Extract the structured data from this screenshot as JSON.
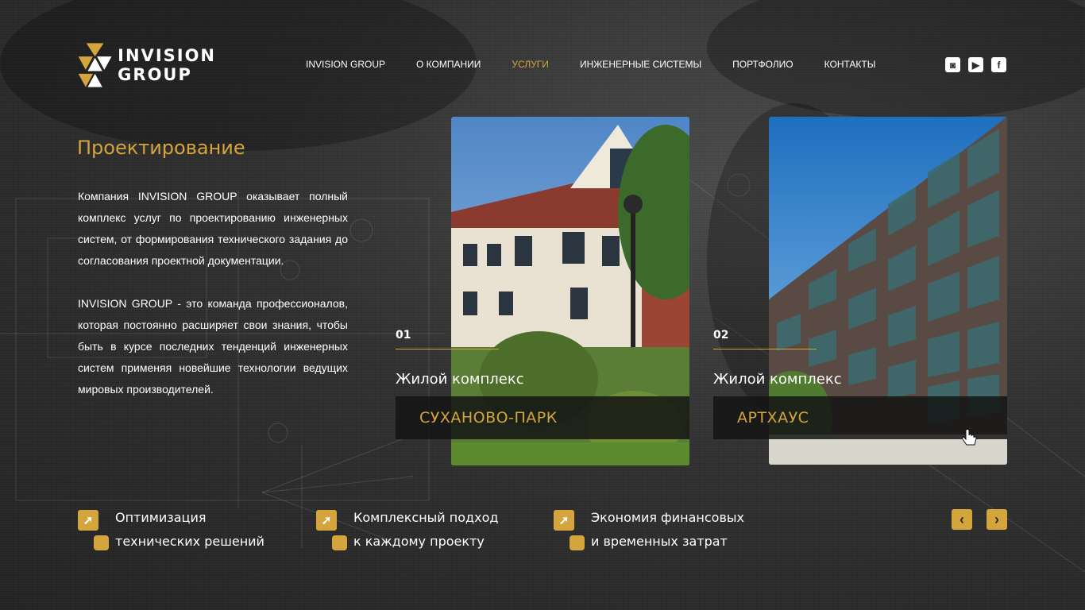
{
  "brand": {
    "line1": "INVISION",
    "line2": "GROUP"
  },
  "nav": [
    {
      "label": "INVISION GROUP",
      "active": false
    },
    {
      "label": "О КОМПАНИИ",
      "active": false
    },
    {
      "label": "УСЛУГИ",
      "active": true
    },
    {
      "label": "ИНЖЕНЕРНЫЕ СИСТЕМЫ",
      "active": false
    },
    {
      "label": "ПОРТФОЛИО",
      "active": false
    },
    {
      "label": "КОНТАКТЫ",
      "active": false
    }
  ],
  "social": [
    {
      "icon": "instagram-icon",
      "glyph": "◙"
    },
    {
      "icon": "youtube-icon",
      "glyph": "▶"
    },
    {
      "icon": "facebook-icon",
      "glyph": "f"
    }
  ],
  "page": {
    "title": "Проектирование",
    "paragraph1": "Компания INVISION GROUP оказывает полный комплекс услуг по проектированию инженерных систем, от формирования технического задания до согласования проектной документации.",
    "paragraph2": "INVISION GROUP - это команда профессионалов, которая постоянно расширяет свои знания, чтобы быть в курсе последних тенденций инженерных систем применяя новейшие технологии ведущих мировых производителей."
  },
  "projects": [
    {
      "number": "01",
      "type": "Жилой комплекс",
      "name": "СУХАНОВО-ПАРК"
    },
    {
      "number": "02",
      "type": "Жилой комплекс",
      "name": "АРТХАУС"
    }
  ],
  "features": [
    {
      "line1": "Оптимизация",
      "line2": "технических решений"
    },
    {
      "line1": "Комплексный подход",
      "line2": "к каждому проекту"
    },
    {
      "line1": "Экономия финансовых",
      "line2": "и временных затрат"
    }
  ],
  "controls": {
    "prev": "‹",
    "next": "›"
  },
  "colors": {
    "accent": "#d4a53c",
    "background": "#2b2b2b"
  }
}
